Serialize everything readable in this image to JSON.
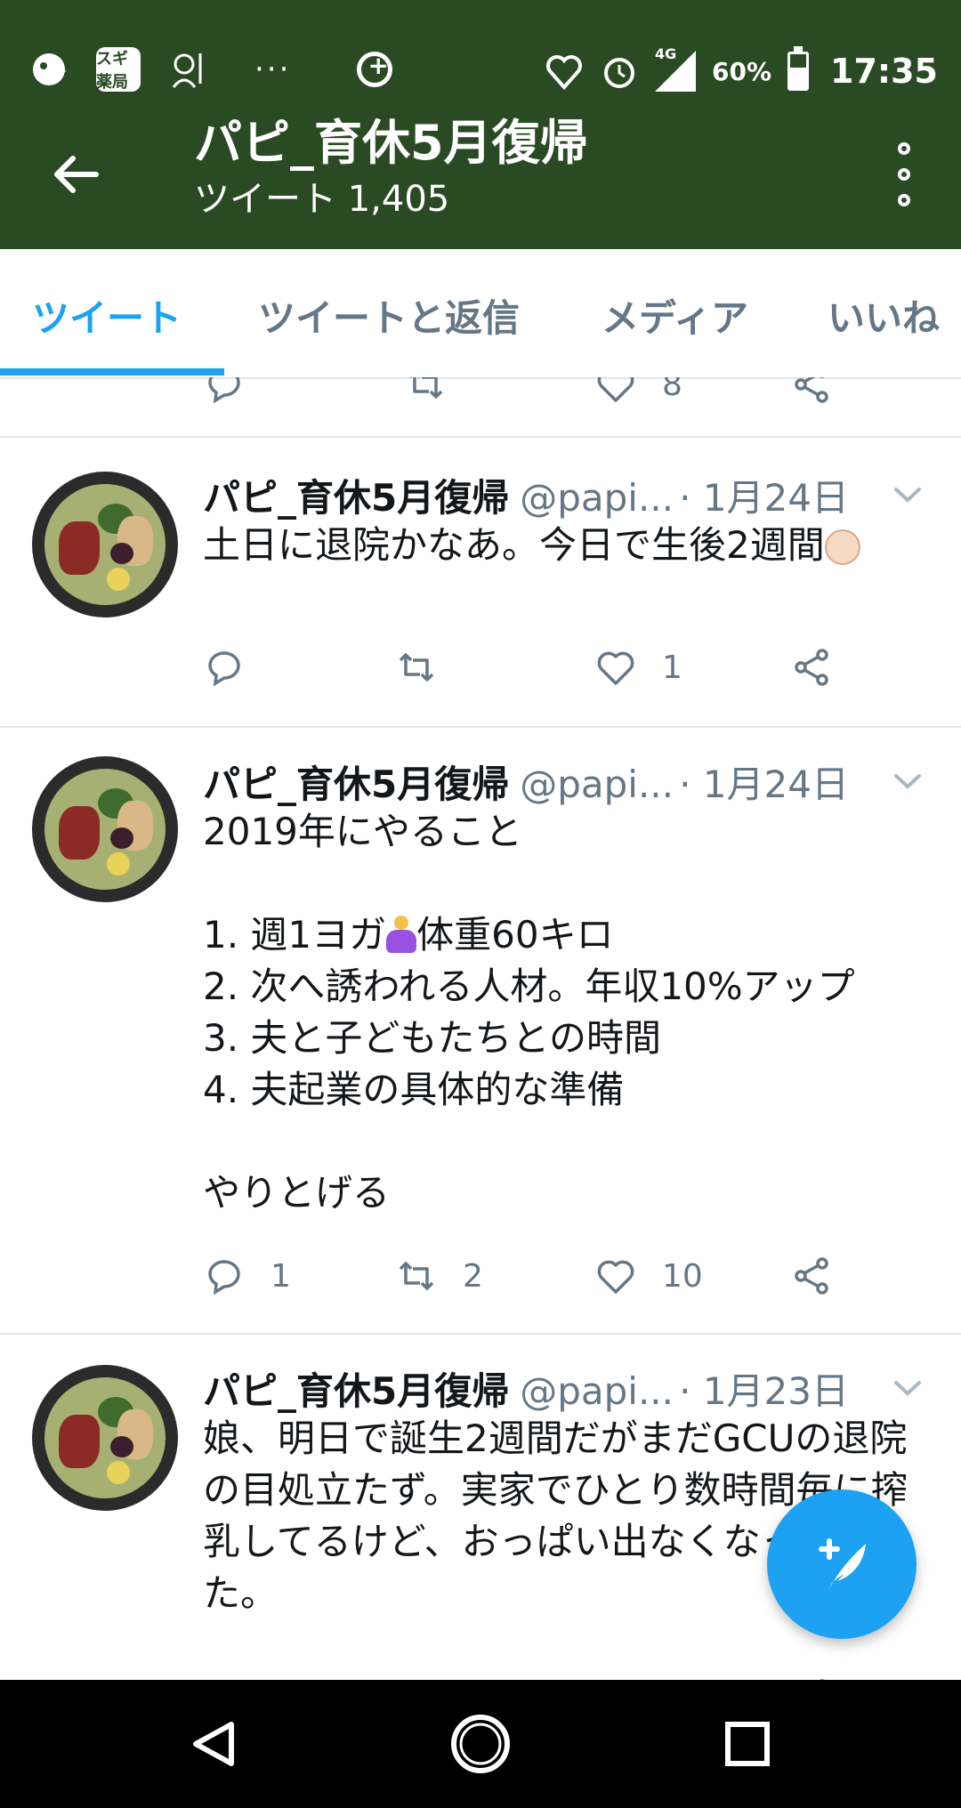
{
  "status_bar": {
    "apps": [
      "parrot-app-icon",
      "sugi-pharmacy-app-icon",
      "cook-app-icon"
    ],
    "sugi_label": "スギ薬局",
    "overflow": "···",
    "network": "4G",
    "battery": "60%",
    "battery_level": 0.6,
    "time": "17:35"
  },
  "header": {
    "title": "パピ_育休5月復帰",
    "subtitle": "ツイート 1,405"
  },
  "tabs": [
    {
      "label": "ツイート",
      "active": true
    },
    {
      "label": "ツイートと返信",
      "active": false
    },
    {
      "label": "メディア",
      "active": false
    },
    {
      "label": "いいね",
      "active": false
    }
  ],
  "previous_tweet": {
    "likes": "8"
  },
  "tweets": [
    {
      "name": "パピ_育休5月復帰",
      "handle": "@papi...",
      "date": "· 1月24日",
      "text_before_emoji": "土日に退院かなあ。今日で生後2週間",
      "replies": "",
      "retweets": "",
      "likes": "1"
    },
    {
      "name": "パピ_育休5月復帰",
      "handle": "@papi...",
      "date": "· 1月24日",
      "line1": "2019年にやること",
      "line2_before_emoji": "1. 週1ヨガ",
      "line2_after_emoji": "体重60キロ",
      "rest": "2. 次へ誘われる人材。年収10%アップ\n3. 夫と子どもたちとの時間\n4. 夫起業の具体的な準備\n\nやりとげる",
      "replies": "1",
      "retweets": "2",
      "likes": "10"
    },
    {
      "name": "パピ_育休5月復帰",
      "handle": "@papi...",
      "date": "· 1月23日",
      "text": "娘、明日で誕生2週間だがまだGCUの退院の目処立たず。実家でひとり数時間毎に搾乳してるけど、おっぱい出なくなってきた。"
    }
  ],
  "colors": {
    "header_bg": "#2a4a24",
    "accent": "#1da1f2",
    "muted": "#657786"
  }
}
